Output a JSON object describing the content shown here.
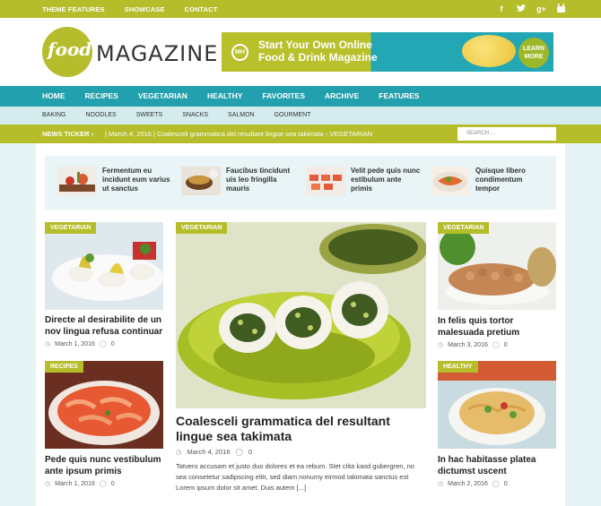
{
  "topbar": {
    "links": [
      "THEME FEATURES",
      "SHOWCASE",
      "CONTACT"
    ],
    "social_icons": [
      "facebook-icon",
      "twitter-icon",
      "google-plus-icon",
      "youtube-icon"
    ]
  },
  "header": {
    "logo_word": "food",
    "logo_title": "MAGAZINE",
    "banner": {
      "badge": "MH",
      "line1": "Start Your Own Online",
      "line2": "Food & Drink Magazine",
      "cta_line1": "LEARN",
      "cta_line2": "MORE"
    }
  },
  "main_nav": [
    "HOME",
    "RECIPES",
    "VEGETARIAN",
    "HEALTHY",
    "FAVORITES",
    "ARCHIVE",
    "FEATURES"
  ],
  "sub_nav": [
    "BAKING",
    "NOODLES",
    "SWEETS",
    "SNACKS",
    "SALMON",
    "GOURMENT"
  ],
  "ticker": {
    "label": "NEWS TICKER",
    "separator": "›",
    "item": "| March 4, 2016 | Coalesceli grammatica del resultant lingue sea takimata › VEGETARIAN",
    "search_placeholder": "SEARCH ..."
  },
  "featured": [
    {
      "title": "Fermentum eu incidunt eum varius ut sanctus"
    },
    {
      "title": "Faucibus tincidunt uis leo fringilla mauris"
    },
    {
      "title": "Velit pede quis nunc estibulum ante primis"
    },
    {
      "title": "Quisque libero condimentum tempor"
    }
  ],
  "cards": {
    "left1": {
      "category": "VEGETARIAN",
      "title": "Directe al desirabilite de un nov lingua refusa continuar",
      "date": "March 1, 2016",
      "comments": "0"
    },
    "left2": {
      "category": "RECIPES",
      "title": "Pede quis nunc vestibulum ante ipsum primis",
      "date": "March 1, 2016",
      "comments": "0"
    },
    "center": {
      "category": "VEGETARIAN",
      "title": "Coalesceli grammatica del resultant lingue sea takimata",
      "date": "March 4, 2016",
      "comments": "0",
      "excerpt": "Tatvero accusam et justo duo dolores et ea rebum. Stet clita kasd gubergren, no sea consetetur sadipscing elitr, sed diam nonumy eirmod takimata sanctus est Lorem ipsum dolor sit amet. Duis autem [...]"
    },
    "right1": {
      "category": "VEGETARIAN",
      "title": "In felis quis tortor malesuada pretium",
      "date": "March 3, 2016",
      "comments": "0"
    },
    "right2": {
      "category": "HEALTHY",
      "title": "In hac habitasse platea dictumst uscent",
      "date": "March 2, 2016",
      "comments": "0"
    }
  },
  "colors": {
    "lime": "#b6bd2a",
    "teal": "#23a0ad",
    "light_teal": "#d5ecee"
  }
}
